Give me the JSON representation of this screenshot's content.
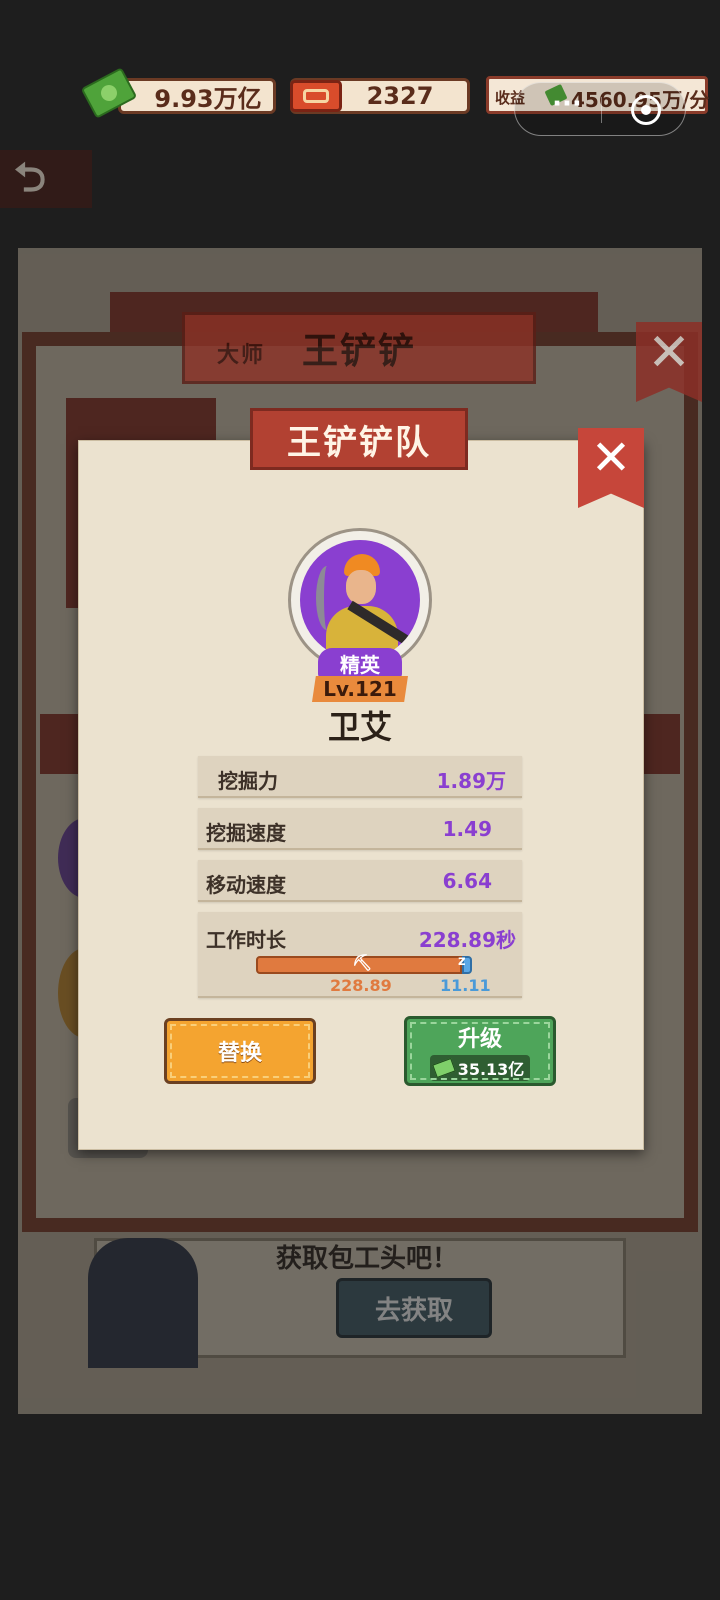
{
  "top_bar": {
    "cash": "9.93万亿",
    "tickets": "2327",
    "income_label": "收益",
    "income_value": "4560.95万/分",
    "cash_icon": "cash-bundle-icon",
    "ticket_icon": "ticket-icon"
  },
  "background": {
    "rank_label": "大师",
    "manager_name": "王铲铲",
    "prompt_text": "获取包工头吧！",
    "go_get_label": "去获取"
  },
  "dialog": {
    "title": "王铲铲队",
    "rank": "精英",
    "level": "Lv.121",
    "name": "卫艾",
    "stats": [
      {
        "label": "挖掘力",
        "value": "1.89万"
      },
      {
        "label": "挖掘速度",
        "value": "1.49"
      },
      {
        "label": "移动速度",
        "value": "6.64"
      }
    ],
    "work_time": {
      "label": "工作时长",
      "value": "228.89秒",
      "work_seconds": "228.89",
      "rest_seconds": "11.11",
      "work_fraction": 0.954
    },
    "replace_label": "替换",
    "upgrade_label": "升级",
    "upgrade_cost": "35.13亿"
  },
  "colors": {
    "accent_purple": "#8a3fd0",
    "banner_red": "#b24132",
    "button_orange": "#f4a430",
    "button_green": "#4ea55a"
  }
}
